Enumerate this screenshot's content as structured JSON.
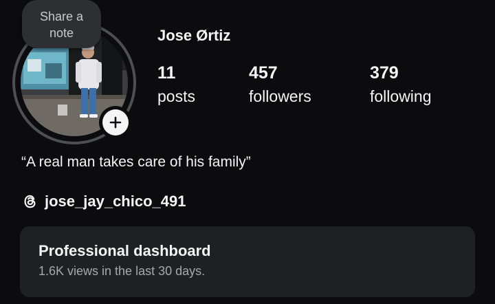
{
  "profile": {
    "username": "Jose Ørtiz",
    "note": {
      "placeholder": "Share a note"
    },
    "stats": [
      {
        "count": "11",
        "label": "posts"
      },
      {
        "count": "457",
        "label": "followers"
      },
      {
        "count": "379",
        "label": "following"
      }
    ],
    "bio": "“A real man takes care of his family”",
    "threads_handle": "jose_jay_chico_491"
  },
  "dashboard": {
    "title": "Professional dashboard",
    "subtitle": "1.6K views in the last 30 days."
  },
  "icons": {
    "add": "plus-icon",
    "threads": "threads-icon"
  },
  "colors": {
    "background": "#0c0c0f",
    "card": "#1f2024",
    "note_bubble": "#2e2f33",
    "text_primary": "#f5f5f5",
    "text_secondary": "#a8a8ad"
  }
}
